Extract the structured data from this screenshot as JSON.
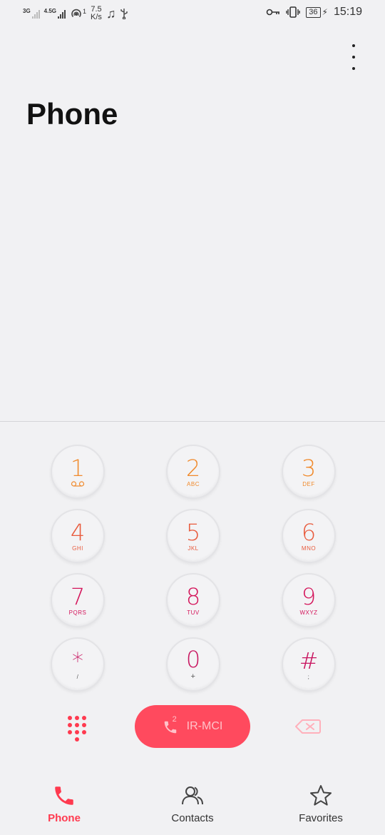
{
  "status_bar": {
    "net1": "3G",
    "net2": "4.5G",
    "hotspot_count": "1",
    "speed_value": "7.5",
    "speed_unit": "K/s",
    "battery": "36",
    "time": "15:19"
  },
  "header": {
    "title": "Phone"
  },
  "keypad": {
    "keys": [
      {
        "digit": "1",
        "letters": ""
      },
      {
        "digit": "2",
        "letters": "ABC"
      },
      {
        "digit": "3",
        "letters": "DEF"
      },
      {
        "digit": "4",
        "letters": "GHI"
      },
      {
        "digit": "5",
        "letters": "JKL"
      },
      {
        "digit": "6",
        "letters": "MNO"
      },
      {
        "digit": "7",
        "letters": "PQRS"
      },
      {
        "digit": "8",
        "letters": "TUV"
      },
      {
        "digit": "9",
        "letters": "WXYZ"
      },
      {
        "digit": "*",
        "letters": "/"
      },
      {
        "digit": "0",
        "letters": "+"
      },
      {
        "digit": "#",
        "letters": ";"
      }
    ]
  },
  "call": {
    "sim": "2",
    "carrier": "IR-MCI"
  },
  "bottom_nav": {
    "items": [
      {
        "label": "Phone",
        "icon": "phone-icon",
        "active": true
      },
      {
        "label": "Contacts",
        "icon": "contacts-icon",
        "active": false
      },
      {
        "label": "Favorites",
        "icon": "star-icon",
        "active": false
      }
    ]
  },
  "colors": {
    "accent": "#ff4a5e",
    "key_orange": "#f08a2c",
    "key_coral": "#e85a3c",
    "key_magenta": "#d4145a"
  }
}
